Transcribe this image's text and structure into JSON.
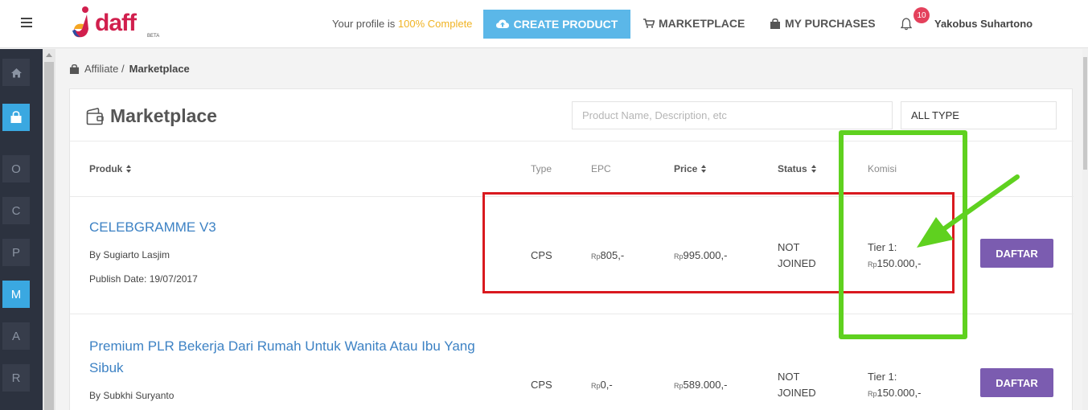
{
  "header": {
    "logo_text": "daff",
    "logo_beta": "BETA",
    "profile_prefix": "Your profile is ",
    "profile_pct": "100% Complete",
    "create_product": "CREATE PRODUCT",
    "marketplace": "MARKETPLACE",
    "my_purchases": "MY PURCHASES",
    "notif_count": "10",
    "username": "Yakobus Suhartono"
  },
  "sidebar": {
    "items": [
      {
        "label": "home-icon"
      },
      {
        "label": "shopping-bag-icon"
      },
      {
        "label": "O"
      },
      {
        "label": "C"
      },
      {
        "label": "P"
      },
      {
        "label": "M"
      },
      {
        "label": "A"
      },
      {
        "label": "R"
      }
    ]
  },
  "breadcrumb": {
    "parent": "Affiliate /",
    "current": "Marketplace"
  },
  "panel": {
    "title": "Marketplace",
    "search_placeholder": "Product Name, Description, etc",
    "type_filter": "ALL TYPE"
  },
  "table": {
    "headers": {
      "produk": "Produk",
      "type": "Type",
      "epc": "EPC",
      "price": "Price",
      "status": "Status",
      "komisi": "Komisi"
    },
    "rows": [
      {
        "name": "CELEBGRAMME V3",
        "author": "By Sugiarto Lasjim",
        "publish": "Publish Date: 19/07/2017",
        "type": "CPS",
        "epc_cur": "Rp",
        "epc": "805,-",
        "price_cur": "Rp",
        "price": "995.000,-",
        "status_l1": "NOT",
        "status_l2": "JOINED",
        "komisi_tier": "Tier 1:",
        "komisi_cur": "Rp",
        "komisi": "150.000,-",
        "action": "DAFTAR"
      },
      {
        "name": "Premium PLR Bekerja Dari Rumah Untuk Wanita Atau Ibu Yang Sibuk",
        "author": "By Subkhi Suryanto",
        "type": "CPS",
        "epc_cur": "Rp",
        "epc": "0,-",
        "price_cur": "Rp",
        "price": "589.000,-",
        "status_l1": "NOT",
        "status_l2": "JOINED",
        "komisi_tier": "Tier 1:",
        "komisi_cur": "Rp",
        "komisi": "150.000,-",
        "action": "DAFTAR"
      }
    ]
  },
  "colors": {
    "accent": "#5bb7e8",
    "sidebar_bg": "#2c323f",
    "daftar": "#7b5cb0",
    "link": "#3d82c4",
    "annotation_red": "#d9191f",
    "annotation_green": "#5fd11f"
  }
}
